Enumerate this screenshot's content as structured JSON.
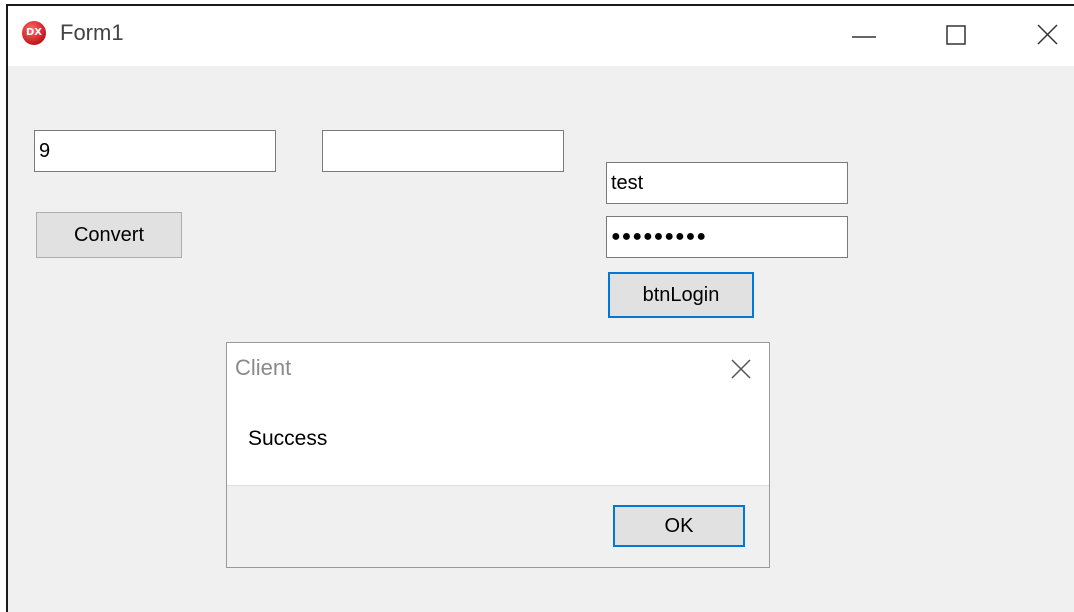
{
  "window": {
    "title": "Form1",
    "icon": "devexpress-app-icon",
    "icon_label": "DX",
    "controls": [
      "minimize-icon",
      "maximize-icon",
      "close-icon"
    ]
  },
  "form": {
    "input_left": {
      "value": "9",
      "placeholder": ""
    },
    "input_right": {
      "value": "",
      "placeholder": ""
    },
    "convert_label": "Convert",
    "username": {
      "value": "test"
    },
    "password": {
      "value": "●●●●●●●●●"
    },
    "login_label": "btnLogin"
  },
  "dialog": {
    "title": "Client",
    "message": "Success",
    "ok_label": "OK",
    "close_icon": "close-icon"
  },
  "colors": {
    "focus_border": "#0078d7",
    "window_bg": "#f0f0f0",
    "button_bg": "#e1e1e1"
  }
}
